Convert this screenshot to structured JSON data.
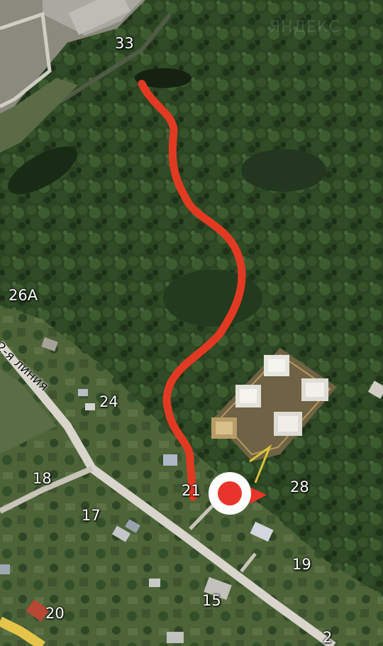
{
  "map": {
    "style": "satellite",
    "labels": {
      "n33": "33",
      "n26a": "26A",
      "n24": "24",
      "n18": "18",
      "n17": "17",
      "n21": "21",
      "n28": "28",
      "n19": "19",
      "n15": "15",
      "n20": "20",
      "n2": "2"
    },
    "street": "2-я линия",
    "watermark": "ЯНДЕКС"
  },
  "route": {
    "color": "#e23a22"
  },
  "user_marker": {
    "color": "#e8342a",
    "ring_color": "#ffffff",
    "heading_icon": "direction-arrow-icon"
  }
}
